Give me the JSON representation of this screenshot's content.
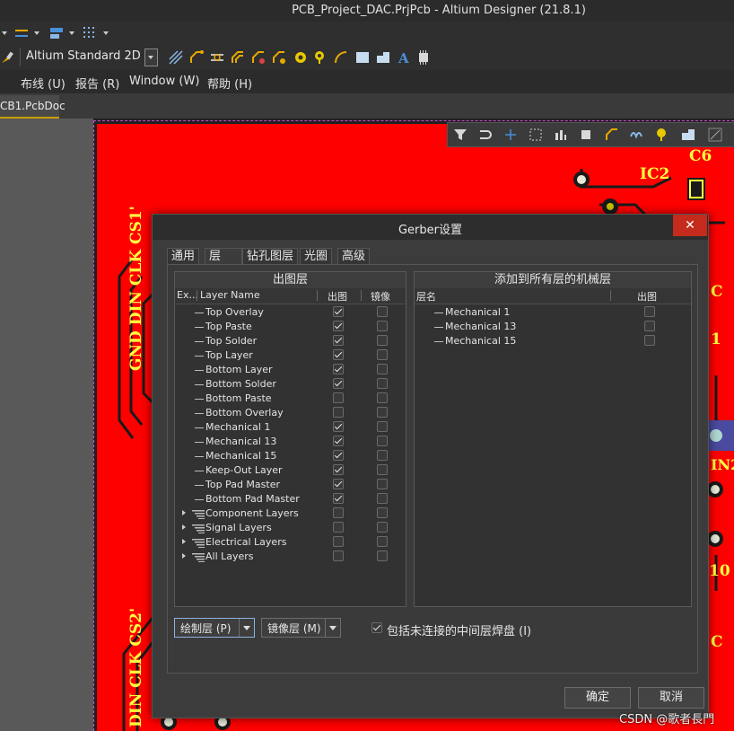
{
  "window": {
    "title": "PCB_Project_DAC.PrjPcb - Altium Designer (21.8.1)"
  },
  "toolbar": {
    "view_select": "Altium Standard 2D"
  },
  "menu": {
    "items": [
      "",
      "布线 (U)",
      "报告 (R)",
      "Window (W)",
      "帮助 (H)"
    ]
  },
  "document_tab": "CB1.PcbDoc",
  "pcb": {
    "silkscreen": {
      "left_top": "GND DIN CLK CS1'",
      "left_bottom": "DIN CLK CS2'",
      "ic2": "IC2",
      "c6": "C6",
      "in2": "IN2",
      "c": "C",
      "one": "1",
      "ten": "10",
      "c_bottom": "C"
    }
  },
  "dialog": {
    "title": "Gerber设置",
    "close": "✕",
    "tabs": [
      "通用",
      "层",
      "钻孔图层",
      "光圈",
      "高级"
    ],
    "active_tab": "层",
    "left_panel": {
      "header": "出图层",
      "columns": {
        "expand": "Ex...",
        "name": "Layer Name",
        "plot": "出图",
        "mirror": "镜像"
      },
      "rows": [
        {
          "name": "Top Overlay",
          "plot": true,
          "mirror": false,
          "group": false
        },
        {
          "name": "Top Paste",
          "plot": true,
          "mirror": false,
          "group": false
        },
        {
          "name": "Top Solder",
          "plot": true,
          "mirror": false,
          "group": false
        },
        {
          "name": "Top Layer",
          "plot": true,
          "mirror": false,
          "group": false
        },
        {
          "name": "Bottom Layer",
          "plot": true,
          "mirror": false,
          "group": false
        },
        {
          "name": "Bottom Solder",
          "plot": true,
          "mirror": false,
          "group": false
        },
        {
          "name": "Bottom Paste",
          "plot": false,
          "mirror": false,
          "group": false
        },
        {
          "name": "Bottom Overlay",
          "plot": false,
          "mirror": false,
          "group": false
        },
        {
          "name": "Mechanical 1",
          "plot": true,
          "mirror": false,
          "group": false
        },
        {
          "name": "Mechanical 13",
          "plot": true,
          "mirror": false,
          "group": false
        },
        {
          "name": "Mechanical 15",
          "plot": true,
          "mirror": false,
          "group": false
        },
        {
          "name": "Keep-Out Layer",
          "plot": true,
          "mirror": false,
          "group": false
        },
        {
          "name": "Top Pad Master",
          "plot": true,
          "mirror": false,
          "group": false
        },
        {
          "name": "Bottom Pad Master",
          "plot": true,
          "mirror": false,
          "group": false
        },
        {
          "name": "Component Layers",
          "plot": false,
          "mirror": false,
          "group": true
        },
        {
          "name": "Signal Layers",
          "plot": false,
          "mirror": false,
          "group": true
        },
        {
          "name": "Electrical Layers",
          "plot": false,
          "mirror": false,
          "group": true
        },
        {
          "name": "All Layers",
          "plot": false,
          "mirror": false,
          "group": true
        }
      ]
    },
    "right_panel": {
      "header": "添加到所有层的机械层",
      "columns": {
        "name": "层名",
        "plot": "出图"
      },
      "rows": [
        {
          "name": "Mechanical 1",
          "plot": false
        },
        {
          "name": "Mechanical 13",
          "plot": false
        },
        {
          "name": "Mechanical 15",
          "plot": false
        }
      ]
    },
    "plot_layers_button": "绘制层 (P)",
    "mirror_layers_button": "镜像层 (M)",
    "include_unconnected": {
      "label": "包括未连接的中间层焊盘 (I)",
      "checked": true
    },
    "ok": "确定",
    "cancel": "取消"
  },
  "watermark": "CSDN @歌者長門"
}
